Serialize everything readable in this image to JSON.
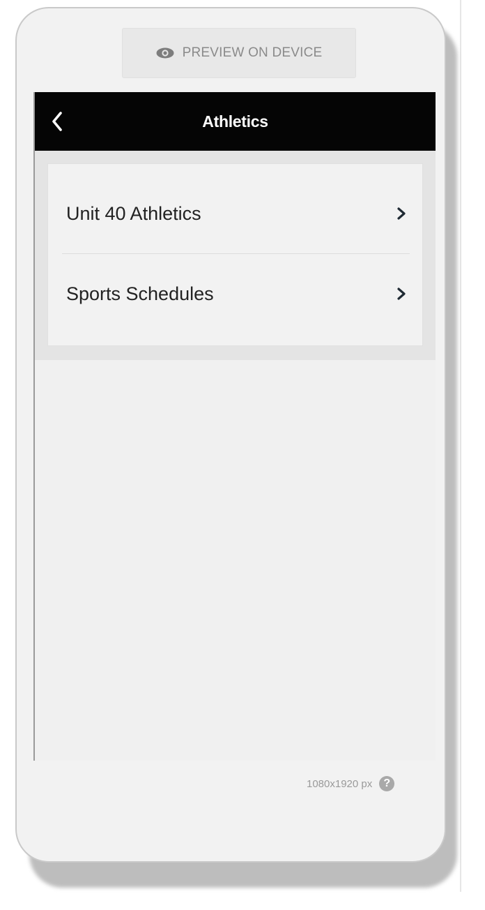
{
  "toolbar": {
    "preview_label": "PREVIEW ON DEVICE",
    "preview_icon": "eye-icon"
  },
  "screen": {
    "header": {
      "title": "Athletics",
      "back_icon": "chevron-left-icon"
    },
    "list": {
      "items": [
        {
          "label": "Unit 40 Athletics",
          "icon": "chevron-right-icon"
        },
        {
          "label": "Sports Schedules",
          "icon": "chevron-right-icon"
        }
      ]
    }
  },
  "footer": {
    "resolution": "1080x1920 px",
    "help_icon": "help-icon",
    "help_glyph": "?"
  },
  "colors": {
    "header_bg": "#050505",
    "header_text": "#ffffff",
    "screen_bg": "#f0f0f0",
    "chevron": "#1f2a33"
  }
}
